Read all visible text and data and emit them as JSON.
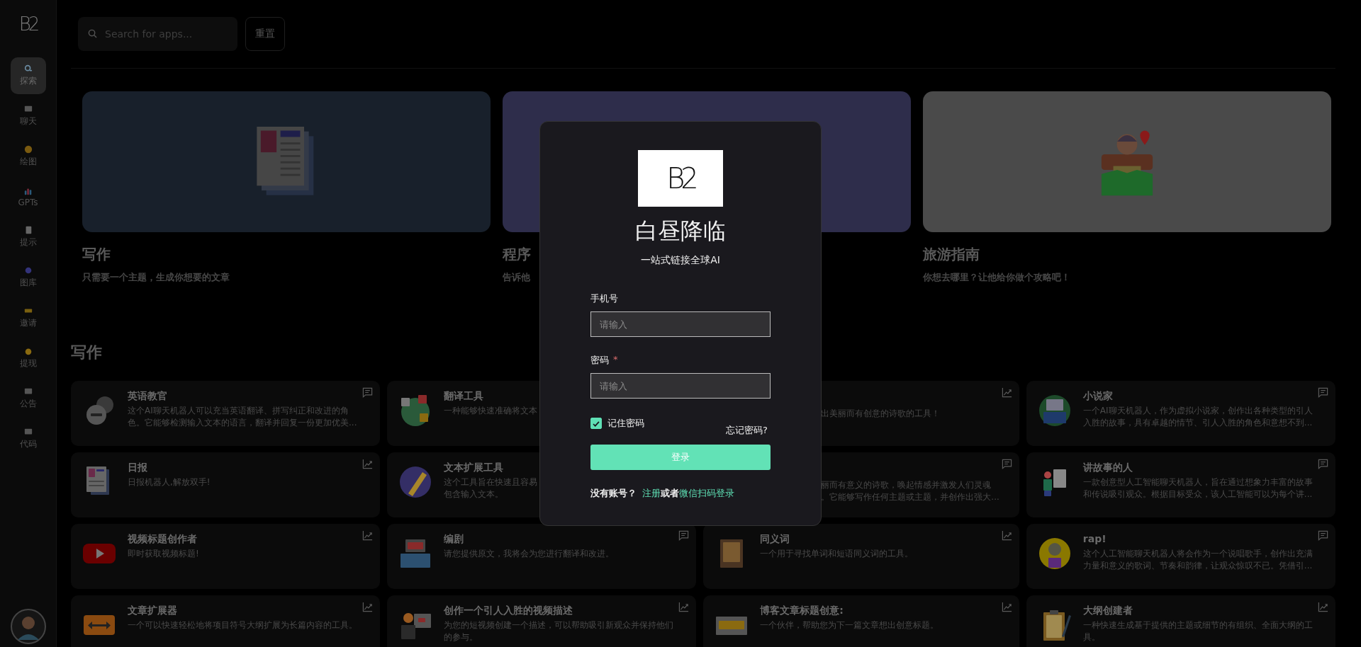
{
  "sidebar": {
    "logo": "B2",
    "items": [
      {
        "label": "探索",
        "selected": true
      },
      {
        "label": "聊天",
        "selected": false
      },
      {
        "label": "绘图",
        "selected": false
      },
      {
        "label": "GPTs",
        "selected": false
      },
      {
        "label": "提示",
        "selected": false
      },
      {
        "label": "图库",
        "selected": false
      },
      {
        "label": "邀请",
        "selected": false
      },
      {
        "label": "提现",
        "selected": false
      },
      {
        "label": "公告",
        "selected": false
      },
      {
        "label": "代码",
        "selected": false
      }
    ]
  },
  "toolbar": {
    "search": {
      "placeholder": "Search for apps..."
    },
    "reset_button": "重置"
  },
  "featured": [
    {
      "title": "写作",
      "description": "只需要一个主题，生成你想要的文章",
      "color": "#18202b"
    },
    {
      "title": "程序",
      "description": "告诉他",
      "color": "#2e2d4b"
    },
    {
      "title": "旅游指南",
      "description": "你想去哪里？让他给你做个攻略吧！",
      "color": "#4a4a4a"
    }
  ],
  "section_title": "写作",
  "apps": [
    {
      "kind": "full",
      "title": "英语教官",
      "description": "这个AI聊天机器人可以充当英语翻译、拼写纠正和改进的角色。它能够检测输入文本的语言，翻译并回复一份更加优美...",
      "corner": {
        "kind": "chat"
      }
    },
    {
      "kind": "left-visible",
      "title": "翻译工具",
      "description_lines": [
        "一种能够快速准确将文本"
      ]
    },
    {
      "kind": "right-visible",
      "description_lines": [
        "出美丽而有创意的诗歌的工具！"
      ],
      "corner": {
        "kind": "trend"
      }
    },
    {
      "kind": "full",
      "title": "小说家",
      "description": "一个AI聊天机器人，作为虚拟小说家，创作出各种类型的引人入胜的故事，具有卓越的情节、引人入胜的角色和意想不到...",
      "corner": {
        "kind": "chat"
      }
    },
    {
      "kind": "full",
      "title": "日报",
      "description": "日报机器人,解放双手!",
      "corner": {
        "kind": "trend"
      }
    },
    {
      "kind": "left-visible",
      "title": "文本扩展工具",
      "description_lines": [
        "这个工具旨在快速且容易",
        "包含输入文本。"
      ]
    },
    {
      "kind": "right-visible",
      "description_lines": [
        "丽而有意义的诗歌，唤起情感并激发人们灵魂",
        "。它能够写作任何主题或主题，并创作出强大..."
      ],
      "corner": {
        "kind": "chat"
      }
    },
    {
      "kind": "full",
      "title": "讲故事的人",
      "description": "一款创意型人工智能聊天机器人，旨在通过想象力丰富的故事和传说吸引观众。根据目标受众，该人工智能可以为每个讲...",
      "corner": {
        "kind": "chat"
      }
    },
    {
      "kind": "full",
      "title": "视频标题创作者",
      "description": "即时获取视频标题!",
      "corner": {
        "kind": "trend"
      }
    },
    {
      "kind": "full",
      "title": "编剧",
      "description": "请您提供原文，我将会为您进行翻译和改进。",
      "corner": {
        "kind": "chat"
      }
    },
    {
      "kind": "full",
      "title": "同义词",
      "description": "一个用于寻找单词和短语同义词的工具。",
      "corner": {
        "kind": "trend"
      }
    },
    {
      "kind": "full",
      "title": "rap!",
      "description": "这个人工智能聊天机器人将会作为一个说唱歌手，创作出充满力量和意义的歌词、节奏和韵律，让观众惊叹不已。凭借引...",
      "corner": {
        "kind": "chat"
      }
    },
    {
      "kind": "full",
      "title": "文章扩展器",
      "description": "一个可以快速轻松地将项目符号大纲扩展为长篇内容的工具。",
      "corner": {
        "kind": "trend"
      }
    },
    {
      "kind": "full",
      "title": "创作一个引人入胜的视频描述",
      "description": "为您的短视频创建一个描述，可以帮助吸引新观众并保持他们的参与。",
      "corner": {
        "kind": "trend"
      }
    },
    {
      "kind": "full",
      "title": "博客文章标题创意:",
      "description": "一个伙伴，帮助您为下一篇文章想出创意标题。",
      "corner": {
        "kind": "trend"
      }
    },
    {
      "kind": "full",
      "title": "大纲创建者",
      "description": "一种快速生成基于提供的主题或细节的有组织、全面大纲的工具。",
      "corner": {
        "kind": "trend"
      }
    }
  ],
  "login": {
    "logo": "B2",
    "title": "白昼降临",
    "subtitle": "一站式链接全球AI",
    "phone": {
      "label": "手机号",
      "placeholder": "请输入"
    },
    "password": {
      "label": "密码",
      "required_mark": "*",
      "placeholder": "请输入"
    },
    "remember": {
      "label": "记住密码",
      "checked": true
    },
    "forgot_link": "忘记密码?",
    "submit_button": "登录",
    "signup": {
      "prompt": "没有账号？",
      "register_link": "注册",
      "joiner": "或者",
      "wechat_link": "微信扫码登录"
    }
  }
}
